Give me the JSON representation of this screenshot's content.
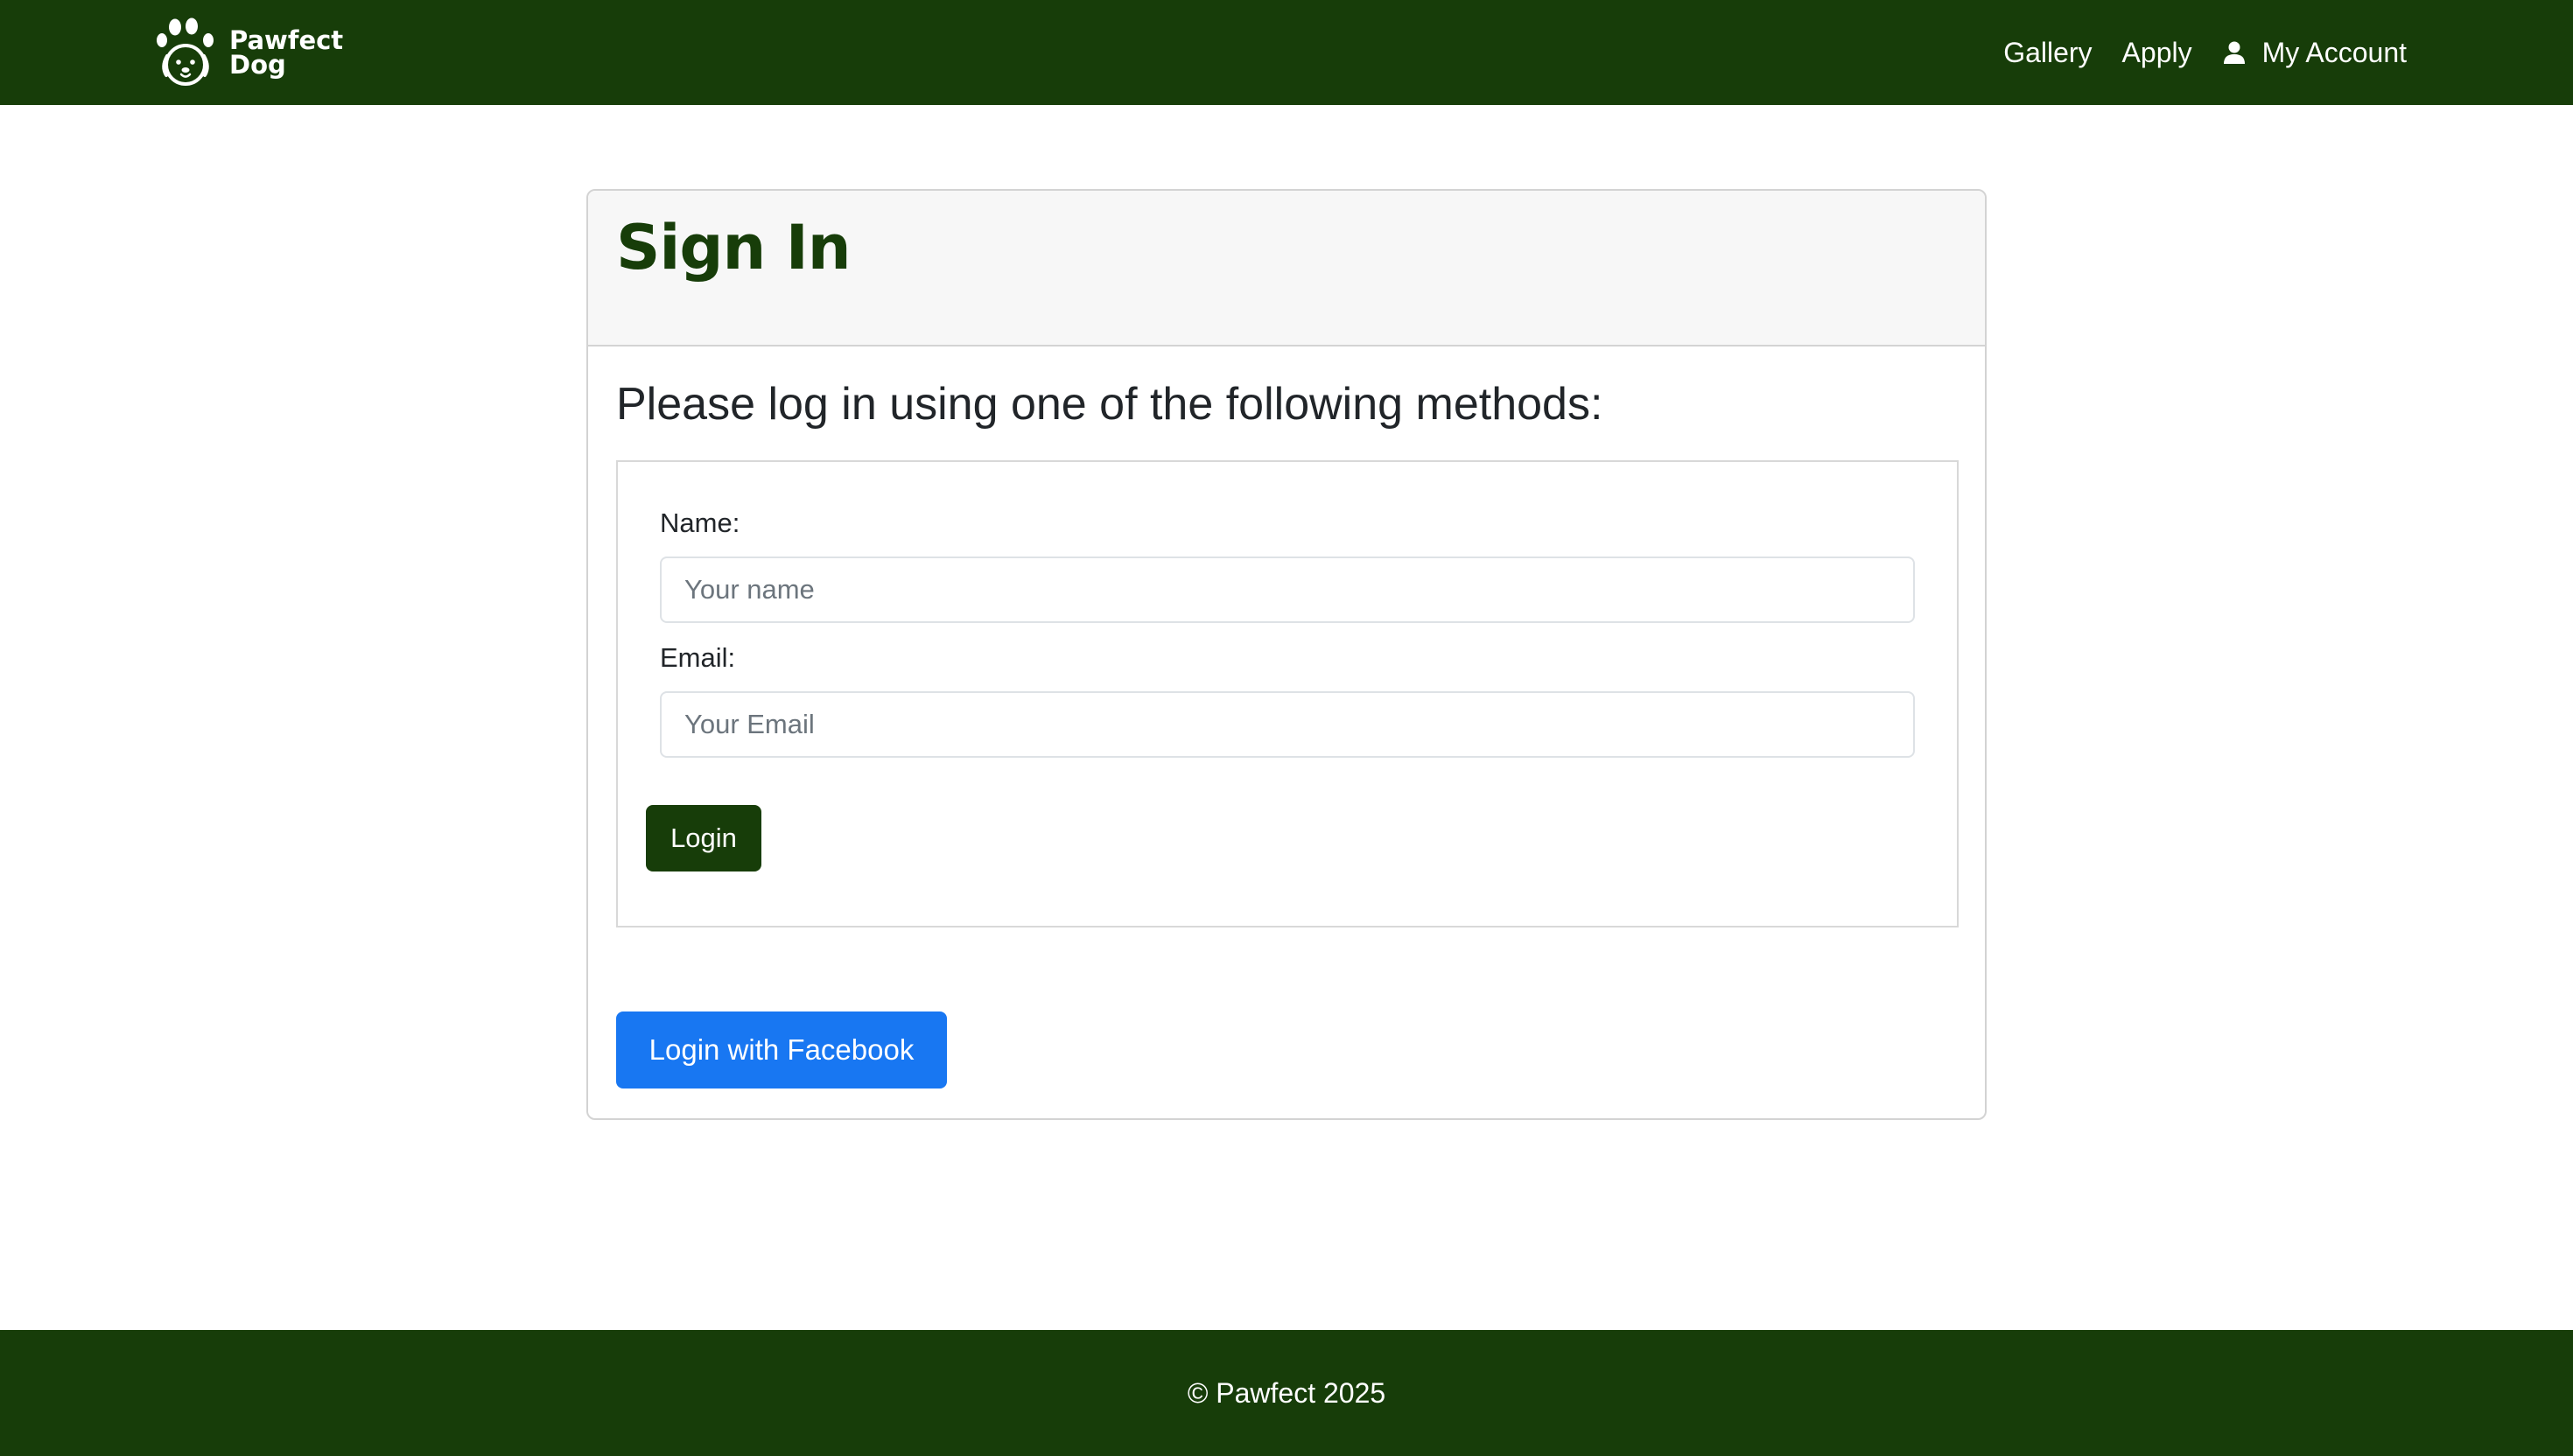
{
  "navbar": {
    "brand": {
      "line1": "Pawfect",
      "line2": "Dog",
      "logo_icon": "paw-dog-icon"
    },
    "links": [
      {
        "label": "Gallery"
      },
      {
        "label": "Apply"
      },
      {
        "label": "My Account",
        "icon": "user-icon"
      }
    ]
  },
  "card": {
    "title": "Sign In",
    "subtitle": "Please log in using one of the following methods:",
    "form": {
      "name_label": "Name:",
      "name_placeholder": "Your name",
      "name_value": "",
      "email_label": "Email:",
      "email_placeholder": "Your Email",
      "email_value": "",
      "submit_label": "Login"
    },
    "facebook_label": "Login with Facebook"
  },
  "footer": {
    "text": "© Pawfect 2025"
  },
  "colors": {
    "brand_green": "#173d09",
    "header_bg": "#f7f7f7",
    "facebook_blue": "#1877f2"
  }
}
